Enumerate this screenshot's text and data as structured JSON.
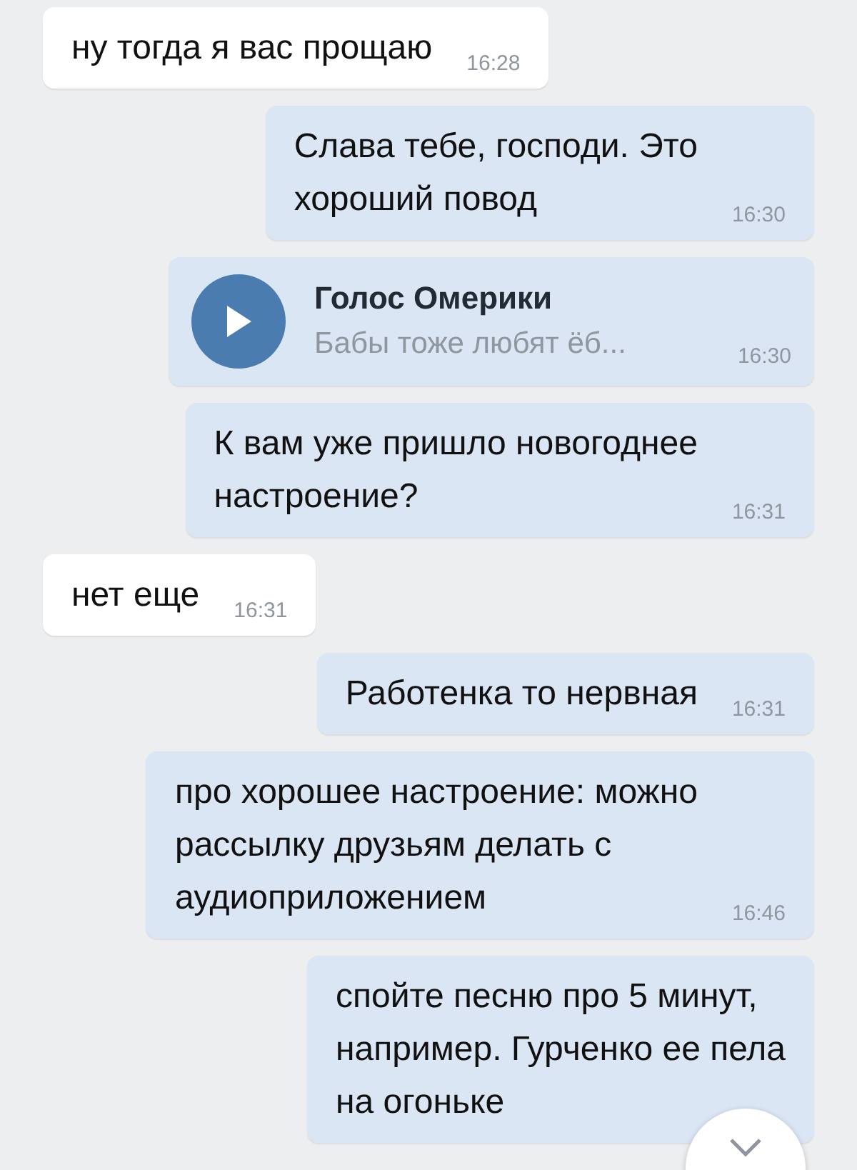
{
  "messages": [
    {
      "kind": "text",
      "outgoing": false,
      "lines": [
        "ну тогда я вас прощаю"
      ],
      "time": "16:28"
    },
    {
      "kind": "text",
      "outgoing": true,
      "lines": [
        "Слава тебе, господи. Это",
        "хороший повод"
      ],
      "time": "16:30"
    },
    {
      "kind": "audio",
      "outgoing": true,
      "title": "Голос Омерики",
      "subtitle": "Бабы тоже любят ёб...",
      "time": "16:30"
    },
    {
      "kind": "text",
      "outgoing": true,
      "lines": [
        "К вам уже пришло новогоднее",
        "настроение?"
      ],
      "time": "16:31"
    },
    {
      "kind": "text",
      "outgoing": false,
      "lines": [
        "нет еще"
      ],
      "time": "16:31"
    },
    {
      "kind": "text",
      "outgoing": true,
      "lines": [
        "Работенка то нервная"
      ],
      "time": "16:31"
    },
    {
      "kind": "text",
      "outgoing": true,
      "lines": [
        "про хорошее настроение: можно",
        "рассылку друзьям делать с",
        "аудиоприложением"
      ],
      "time": "16:46"
    },
    {
      "kind": "text",
      "outgoing": true,
      "lines": [
        "спойте песню про 5 минут,",
        "например. Гурченко ее пела",
        "на огоньке"
      ]
    }
  ]
}
